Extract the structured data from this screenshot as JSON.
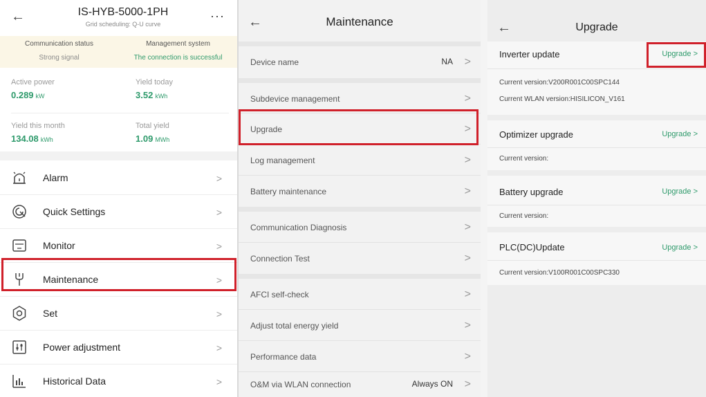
{
  "home": {
    "title": "IS-HYB-5000-1PH",
    "subtitle": "Grid scheduling: Q-U curve",
    "more": "···",
    "status": [
      {
        "label": "Communication status",
        "value": "Strong signal"
      },
      {
        "label": "Management system",
        "value": "The connection is successful"
      }
    ],
    "metrics": [
      {
        "label": "Active power",
        "value": "0.289",
        "unit": "kW"
      },
      {
        "label": "Yield today",
        "value": "3.52",
        "unit": "kWh"
      },
      {
        "label": "Yield this month",
        "value": "134.08",
        "unit": "kWh"
      },
      {
        "label": "Total yield",
        "value": "1.09",
        "unit": "MWh"
      }
    ],
    "menu": [
      {
        "label": "Alarm",
        "icon": "alarm-icon"
      },
      {
        "label": "Quick Settings",
        "icon": "quick-settings-icon"
      },
      {
        "label": "Monitor",
        "icon": "monitor-icon"
      },
      {
        "label": "Maintenance",
        "icon": "maintenance-icon"
      },
      {
        "label": "Set",
        "icon": "settings-icon"
      },
      {
        "label": "Power adjustment",
        "icon": "power-adjustment-icon"
      },
      {
        "label": "Historical Data",
        "icon": "historical-data-icon"
      }
    ]
  },
  "maintenance": {
    "title": "Maintenance",
    "rows": [
      {
        "label": "Device name",
        "value": "NA"
      },
      {
        "label": "Subdevice management",
        "value": ""
      },
      {
        "label": "Upgrade",
        "value": ""
      },
      {
        "label": "Log management",
        "value": ""
      },
      {
        "label": "Battery maintenance",
        "value": ""
      },
      {
        "label": "Communication Diagnosis",
        "value": ""
      },
      {
        "label": "Connection Test",
        "value": ""
      },
      {
        "label": "AFCI self-check",
        "value": ""
      },
      {
        "label": "Adjust total energy yield",
        "value": ""
      },
      {
        "label": "Performance data",
        "value": ""
      },
      {
        "label": "O&M via WLAN connection",
        "value": "Always ON"
      }
    ]
  },
  "upgrade": {
    "title": "Upgrade",
    "sections": [
      {
        "title": "Inverter update",
        "action": "Upgrade >",
        "lines": [
          "Current version:V200R001C00SPC144",
          "Current WLAN version:HISILICON_V161"
        ]
      },
      {
        "title": "Optimizer upgrade",
        "action": "Upgrade >",
        "lines": [
          "Current version:"
        ]
      },
      {
        "title": "Battery upgrade",
        "action": "Upgrade >",
        "lines": [
          "Current version:"
        ]
      },
      {
        "title": "PLC(DC)Update",
        "action": "Upgrade >",
        "lines": [
          "Current version:V100R001C00SPC330"
        ]
      }
    ]
  },
  "colors": {
    "accent": "#2e9a6b",
    "highlight": "#d0202a",
    "status_band": "#fbf6e6"
  },
  "icons": {
    "back": "←",
    "chevron": ">"
  }
}
